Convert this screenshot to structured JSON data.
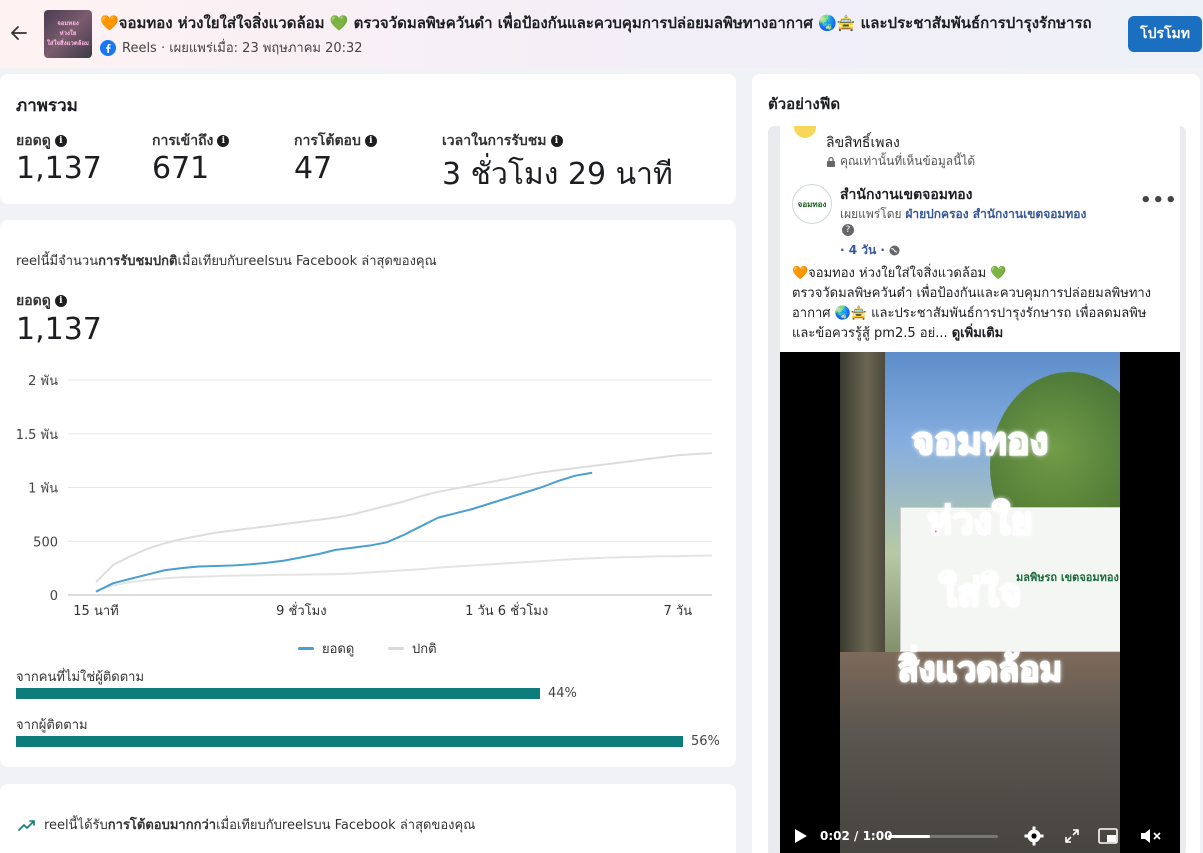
{
  "header": {
    "title": "🧡จอมทอง ห่วงใยใส่ใจสิ่งแวดล้อม 💚 ตรวจวัดมลพิษควันดำ เพื่อป้องกันและควบคุมการปล่อยมลพิษทางอากาศ 🌏🚖 และประชาสัมพันธ์การปารุงรักษารถ",
    "meta": "Reels · เผยแพร่เมื่อ: 23 พฤษภาคม 20:32",
    "promote_label": "โปรโมท",
    "thumb_lines": [
      "จอมทอง",
      "ห่วงใย",
      "ใส่ใจสิ่งแวดล้อม"
    ]
  },
  "overview": {
    "title": "ภาพรวม",
    "metrics": [
      {
        "label": "ยอดดู",
        "value": "1,137"
      },
      {
        "label": "การเข้าถึง",
        "value": "671"
      },
      {
        "label": "การโต้ตอบ",
        "value": "47"
      },
      {
        "label": "เวลาในการรับชม",
        "value": "3 ชั่วโมง 29 นาที"
      }
    ]
  },
  "performance": {
    "note_prefix": "reelนี้มีจำนวน",
    "note_bold": "การรับชมปกติ",
    "note_suffix": "เมื่อเทียบกับreelsบน Facebook ล่าสุดของคุณ",
    "views_label": "ยอดดู",
    "views_value": "1,137",
    "audience": [
      {
        "label": "จากคนที่ไม่ใช่ผู้ติดตาม",
        "percent": 44,
        "percent_text": "44%"
      },
      {
        "label": "จากผู้ติดตาม",
        "percent": 56,
        "percent_text": "56%"
      }
    ]
  },
  "chart_data": {
    "type": "line",
    "y_tick_labels": [
      "2 พัน",
      "1.5 พัน",
      "1 พัน",
      "500",
      "0"
    ],
    "x_tick_labels": [
      "15 นาที",
      "9 ชั่วโมง",
      "1 วัน 6 ชั่วโมง",
      "7 วัน"
    ],
    "ylim": [
      0,
      2000
    ],
    "x_positions": [
      0,
      0.1,
      0.2,
      0.3,
      0.4,
      0.5,
      0.6,
      0.7,
      0.8,
      0.9,
      1.0,
      1.1,
      1.2,
      1.3,
      1.4,
      1.5,
      1.6,
      1.7,
      1.8,
      1.9,
      2.0,
      2.1,
      2.2,
      2.3,
      2.4,
      2.5,
      2.6,
      2.7,
      2.8,
      2.9,
      3.0,
      3.1,
      3.2,
      3.3,
      3.4,
      3.5,
      3.6
    ],
    "series": [
      {
        "name": "ยอดดู",
        "color": "#4a9fd0",
        "values": [
          30,
          110,
          150,
          190,
          230,
          250,
          265,
          270,
          275,
          285,
          300,
          320,
          350,
          380,
          420,
          440,
          460,
          490,
          560,
          640,
          720,
          760,
          800,
          850,
          900,
          950,
          1000,
          1060,
          1110,
          1137
        ]
      },
      {
        "name": "ปกติ",
        "color": "#dddddd",
        "values": [
          120,
          280,
          360,
          430,
          480,
          520,
          550,
          580,
          600,
          620,
          640,
          660,
          680,
          700,
          720,
          750,
          790,
          830,
          870,
          920,
          960,
          990,
          1020,
          1050,
          1080,
          1110,
          1140,
          1160,
          1180,
          1200,
          1220,
          1240,
          1260,
          1280,
          1300,
          1310,
          1320
        ]
      },
      {
        "name": "ปกติ",
        "color": "#e4e4e4",
        "legend": false,
        "values": [
          40,
          90,
          120,
          140,
          155,
          165,
          170,
          175,
          180,
          182,
          185,
          188,
          190,
          192,
          194,
          200,
          210,
          220,
          230,
          240,
          255,
          265,
          275,
          285,
          295,
          305,
          315,
          325,
          335,
          342,
          348,
          352,
          356,
          360,
          362,
          365,
          368
        ]
      }
    ]
  },
  "engagement": {
    "note_prefix": "reelนี้ได้รับ",
    "note_bold": "การโต้ตอบมากกว่า",
    "note_suffix": "เมื่อเทียบกับreelsบน Facebook ล่าสุดของคุณ"
  },
  "preview": {
    "title": "ตัวอย่างฟีด",
    "music_label": "ลิขสิทธิ์เพลง",
    "music_sub": "คุณเท่านั้นที่เห็นข้อมูลนี้ได้",
    "page_name": "สำนักงานเขตจอมทอง",
    "avatar_text": "จอมทอง",
    "publisher_prefix": "เผยแพร่โดย",
    "publisher_name": "ฝ่ายปกครอง สำนักงานเขตจอมทอง",
    "time": "· 4 วัน ·",
    "caption_line1": "🧡จอมทอง ห่วงใยใส่ใจสิ่งแวดล้อม 💚",
    "caption_rest": "ตรวจวัดมลพิษควันดำ เพื่อป้องกันและควบคุมการปล่อยมลพิษทางอากาศ 🌏🚖 และประชาสัมพันธ์การปารุงรักษารถ เพื่อลดมลพิษ และข้อควรรู้สู้ pm2.5 อย่... ",
    "see_more": "ดูเพิ่มเติม",
    "video_words": [
      "จอมทอง",
      "ห่วงใย",
      "ใส่ใจ",
      "สิ่งแวดล้อม"
    ],
    "banner_text": "มลพิษรถ เขตจอมทอง",
    "video_time": "0:02 / 1:00",
    "video_progress": 0.38
  }
}
